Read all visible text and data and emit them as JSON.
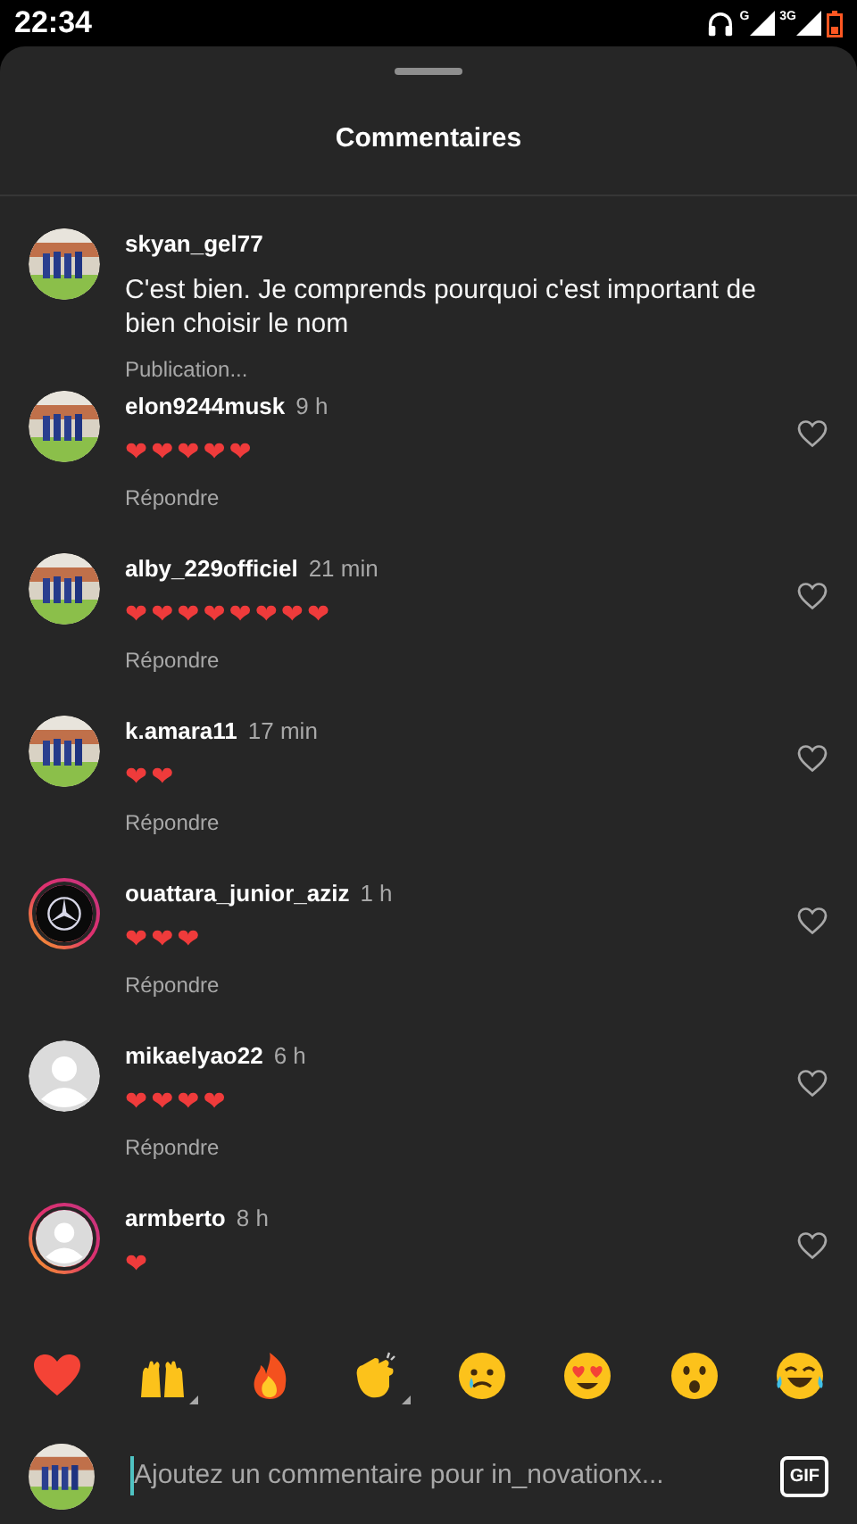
{
  "status_bar": {
    "time": "22:34",
    "network_labels": [
      "G",
      "3G"
    ]
  },
  "sheet": {
    "title": "Commentaires"
  },
  "comments": [
    {
      "username": "skyan_gel77",
      "text": "C'est bien. Je comprends pourquoi c'est important de bien choisir le nom",
      "action": "Publication...",
      "story_ring": false,
      "like_button": false
    },
    {
      "username": "elon9244musk",
      "time": "9 h",
      "text": "❤❤❤❤❤",
      "action": "Répondre",
      "story_ring": false,
      "like_button": true
    },
    {
      "username": "alby_229officiel",
      "time": "21 min",
      "text": "❤❤❤❤❤❤❤❤",
      "action": "Répondre",
      "story_ring": false,
      "like_button": true
    },
    {
      "username": "k.amara11",
      "time": "17 min",
      "text": "❤❤",
      "action": "Répondre",
      "story_ring": false,
      "like_button": true
    },
    {
      "username": "ouattara_junior_aziz",
      "time": "1 h",
      "text": "❤❤❤",
      "action": "Répondre",
      "avatar": {
        "kind": "logo"
      },
      "story_ring": true,
      "like_button": true
    },
    {
      "username": "mikaelyao22",
      "time": "6 h",
      "text": "❤❤❤❤",
      "action": "Répondre",
      "avatar": {
        "kind": "default"
      },
      "story_ring": false,
      "like_button": true
    },
    {
      "username": "armberto",
      "time": "8 h",
      "text": "❤",
      "avatar": {
        "kind": "default"
      },
      "story_ring": true,
      "like_button": true
    }
  ],
  "reactions": [
    {
      "kind": "heart",
      "variants": false
    },
    {
      "kind": "raised-hands",
      "variants": true
    },
    {
      "kind": "fire",
      "variants": false
    },
    {
      "kind": "clap",
      "variants": true
    },
    {
      "kind": "crying",
      "variants": false
    },
    {
      "kind": "heart-eyes",
      "variants": false
    },
    {
      "kind": "surprised",
      "variants": false
    },
    {
      "kind": "laughing",
      "variants": false
    }
  ],
  "composer": {
    "placeholder": "Ajoutez un commentaire pour in_novationx...",
    "gif_label": "GIF"
  }
}
